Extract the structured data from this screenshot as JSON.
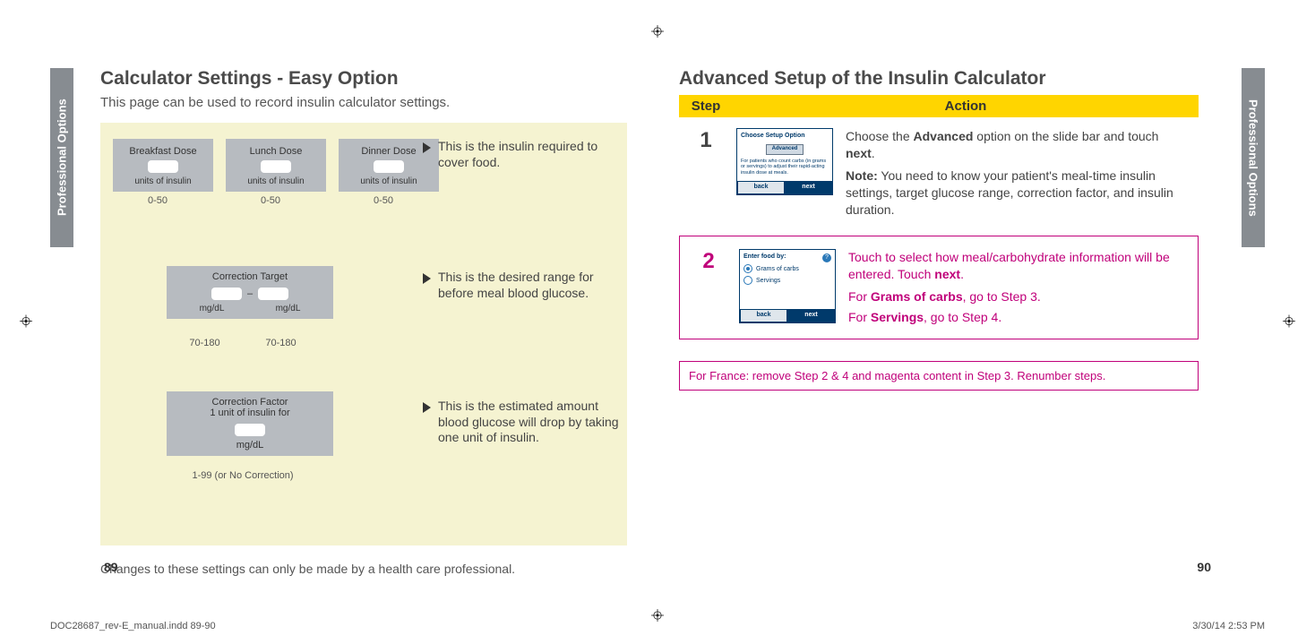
{
  "crop_glyph": "◈",
  "side_tab": "Professional Options",
  "left": {
    "title": "Calculator Settings - Easy Option",
    "subtitle": "This page can be used to record insulin calculator settings.",
    "doses": {
      "breakfast": "Breakfast Dose",
      "lunch": "Lunch Dose",
      "dinner": "Dinner Dose",
      "units": "units of insulin",
      "range": "0-50"
    },
    "note1": "This is the insulin required to cover food.",
    "target": {
      "label": "Correction Target",
      "dash": "–",
      "unit": "mg/dL",
      "range": "70-180"
    },
    "note2": "This is the desired range for before meal blood glucose.",
    "factor": {
      "line1": "Correction Factor",
      "line2": "1 unit of insulin for",
      "unit": "mg/dL",
      "range": "1-99 (or No Correction)"
    },
    "note3": "This is the estimated amount blood glucose will drop by taking one unit of insulin.",
    "footnote": "Changes to these settings can only be made by a health care professional.",
    "page_num": "89"
  },
  "right": {
    "title": "Advanced Setup of the Insulin Calculator",
    "table": {
      "col1": "Step",
      "col2": "Action"
    },
    "step1": {
      "num": "1",
      "screen": {
        "header": "Choose Setup Option",
        "option": "Advanced",
        "desc": "For patients who count carbs (in grams or servings) to adjust their rapid-acting insulin dose at meals.",
        "back": "back",
        "next": "next"
      },
      "line1a": "Choose the ",
      "line1b": "Advanced",
      "line1c": " option on the slide bar and touch ",
      "line1d": "next",
      "line1e": ".",
      "note_label": "Note:",
      "note_text": " You need to know your patient's meal-time insulin settings, target glucose range, correction factor, and insulin duration."
    },
    "step2": {
      "num": "2",
      "screen": {
        "header": "Enter food by:",
        "opt1": "Grams of carbs",
        "opt2": "Servings",
        "help": "?",
        "back": "back",
        "next": "next"
      },
      "line1a": "Touch to select how meal/carbohydrate information will be entered. Touch ",
      "line1b": "next",
      "line1c": ".",
      "line2a": "For ",
      "line2b": "Grams of carbs",
      "line2c": ", go to Step 3.",
      "line3a": "For ",
      "line3b": "Servings",
      "line3c": ", go to Step 4."
    },
    "france": "For France: remove Step 2 & 4 and magenta content in Step 3. Renumber steps.",
    "page_num": "90"
  },
  "footer": {
    "file": "DOC28687_rev-E_manual.indd   89-90",
    "stamp": "3/30/14   2:53 PM"
  }
}
